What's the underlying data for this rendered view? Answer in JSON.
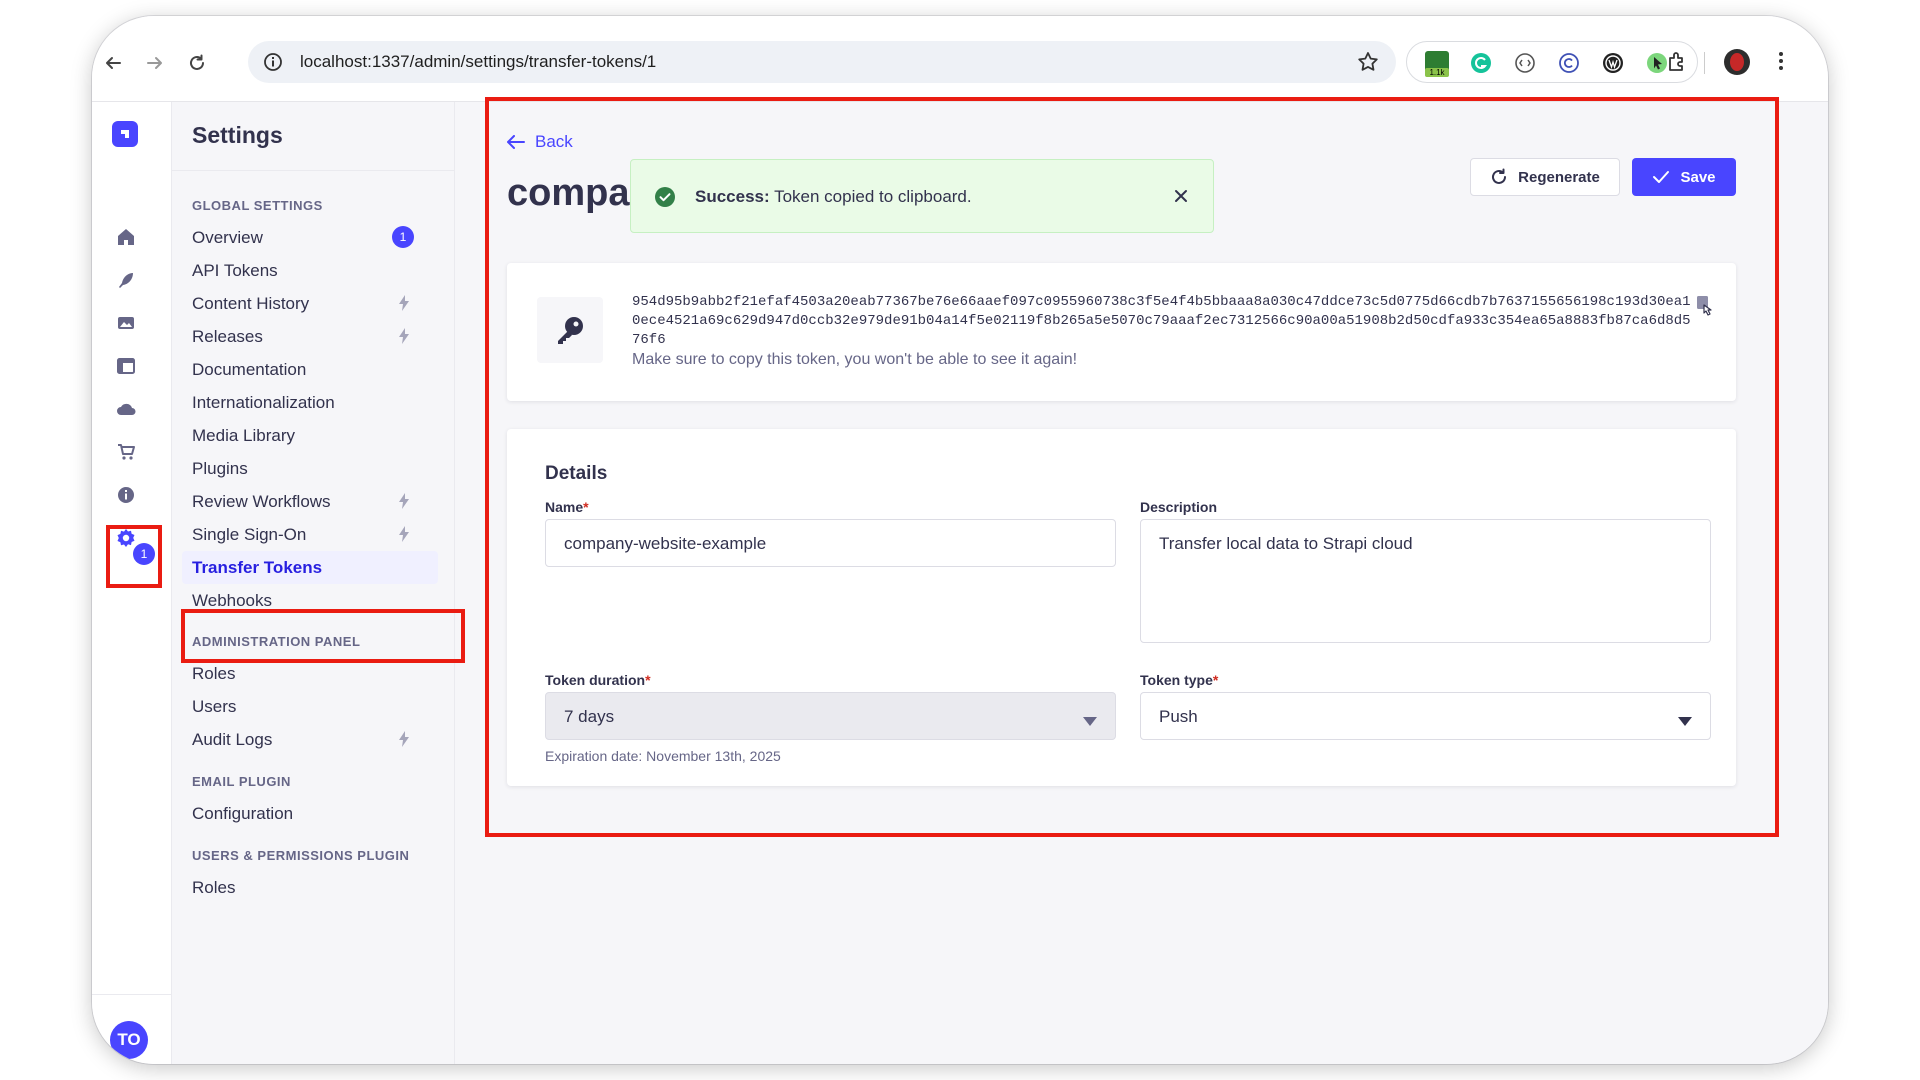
{
  "browser": {
    "url": "localhost:1337/admin/settings/transfer-tokens/1",
    "extension_badge": "1.1k"
  },
  "rail": {
    "settings_badge": "1",
    "avatar_initials": "TO"
  },
  "sidebar": {
    "title": "Settings",
    "global_label": "GLOBAL SETTINGS",
    "global_items": [
      {
        "label": "Overview",
        "badge": "1"
      },
      {
        "label": "API Tokens"
      },
      {
        "label": "Content History",
        "bolt": true
      },
      {
        "label": "Releases",
        "bolt": true
      },
      {
        "label": "Documentation"
      },
      {
        "label": "Internationalization"
      },
      {
        "label": "Media Library"
      },
      {
        "label": "Plugins"
      },
      {
        "label": "Review Workflows",
        "bolt": true
      },
      {
        "label": "Single Sign-On",
        "bolt": true
      },
      {
        "label": "Transfer Tokens",
        "active": true
      },
      {
        "label": "Webhooks"
      }
    ],
    "admin_label": "ADMINISTRATION PANEL",
    "admin_items": [
      {
        "label": "Roles"
      },
      {
        "label": "Users"
      },
      {
        "label": "Audit Logs",
        "bolt": true
      }
    ],
    "email_label": "EMAIL PLUGIN",
    "email_items": [
      {
        "label": "Configuration"
      }
    ],
    "users_label": "USERS & PERMISSIONS PLUGIN",
    "users_items": [
      {
        "label": "Roles"
      }
    ]
  },
  "main": {
    "back_label": "Back",
    "title": "company-website-example",
    "regenerate_label": "Regenerate",
    "save_label": "Save",
    "toast": {
      "title": "Success:",
      "message": "Token copied to clipboard."
    },
    "token": {
      "value": "954d95b9abb2f21efaf4503a20eab77367be76e66aaef097c0955960738c3f5e4f4b5bbaaa8a030c47ddce73c5d0775d66cdb7b7637155656198c193d30ea10ece4521a69c629d947d0ccb32e979de91b04a14f5e02119f8b265a5e5070c79aaaf2ec7312566c90a00a51908b2d50cdfa933c354ea65a8883fb87ca6d8d576f6",
      "hint": "Make sure to copy this token, you won't be able to see it again!"
    },
    "details": {
      "title": "Details",
      "name_label": "Name",
      "name_value": "company-website-example",
      "description_label": "Description",
      "description_value": "Transfer local data to Strapi cloud",
      "duration_label": "Token duration",
      "duration_value": "7 days",
      "expiration": "Expiration date: November 13th, 2025",
      "type_label": "Token type",
      "type_value": "Push",
      "required_mark": "*"
    }
  },
  "colors": {
    "primary": "#4945ff",
    "success_bg": "#eafbe7",
    "success_icon": "#328048",
    "annotation": "#ea1c12"
  }
}
